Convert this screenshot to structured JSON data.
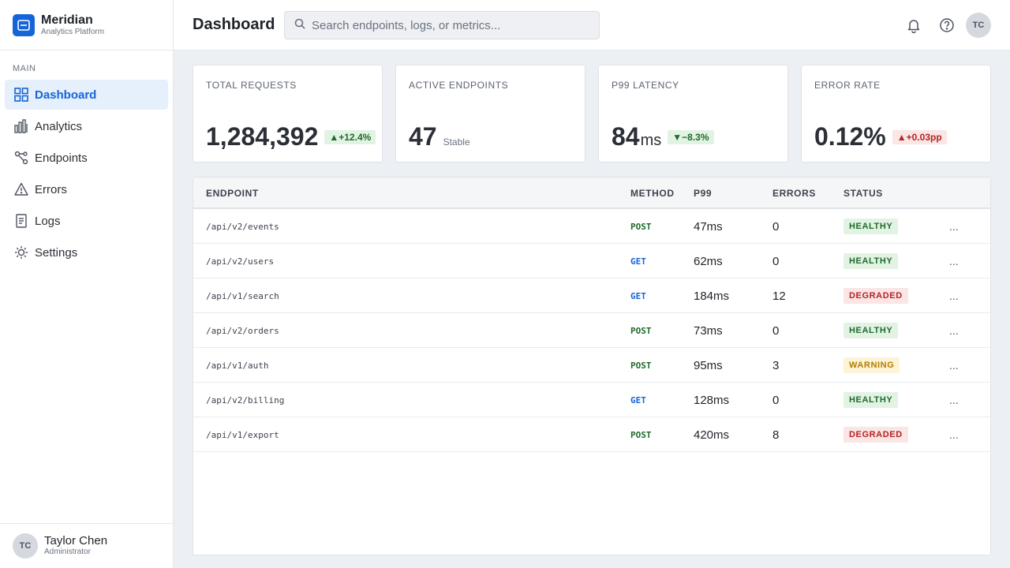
{
  "brand": {
    "name": "Meridian",
    "subtitle": "Analytics Platform"
  },
  "sidebar": {
    "section_label": "MAIN",
    "items": [
      {
        "label": "Dashboard",
        "icon": "grid-icon",
        "active": true
      },
      {
        "label": "Analytics",
        "icon": "bar-chart-icon",
        "active": false
      },
      {
        "label": "Endpoints",
        "icon": "nodes-icon",
        "active": false
      },
      {
        "label": "Errors",
        "icon": "warning-icon",
        "active": false
      },
      {
        "label": "Logs",
        "icon": "document-icon",
        "active": false
      },
      {
        "label": "Settings",
        "icon": "gear-icon",
        "active": false
      }
    ],
    "user": {
      "initials": "TC",
      "name": "Taylor Chen",
      "role": "Administrator"
    }
  },
  "header": {
    "title": "Dashboard",
    "search_placeholder": "Search endpoints, logs, or metrics...",
    "avatar_initials": "TC"
  },
  "cards": [
    {
      "label": "TOTAL REQUESTS",
      "value": "1,284,392",
      "unit": "",
      "delta": "+12.4%",
      "delta_dir": "up",
      "delta_tone": "good",
      "note": ""
    },
    {
      "label": "ACTIVE ENDPOINTS",
      "value": "47",
      "unit": "",
      "delta": "",
      "delta_dir": "",
      "delta_tone": "",
      "note": "Stable"
    },
    {
      "label": "P99 LATENCY",
      "value": "84",
      "unit": "ms",
      "delta": "−8.3%",
      "delta_dir": "down",
      "delta_tone": "good",
      "note": ""
    },
    {
      "label": "ERROR RATE",
      "value": "0.12%",
      "unit": "",
      "delta": "+0.03pp",
      "delta_dir": "up",
      "delta_tone": "bad",
      "note": ""
    }
  ],
  "table": {
    "columns": [
      "ENDPOINT",
      "METHOD",
      "P99",
      "ERRORS",
      "STATUS"
    ],
    "rows": [
      {
        "endpoint": "/api/v2/events",
        "method": "POST",
        "p99": "47ms",
        "errors": "0",
        "status": "HEALTHY"
      },
      {
        "endpoint": "/api/v2/users",
        "method": "GET",
        "p99": "62ms",
        "errors": "0",
        "status": "HEALTHY"
      },
      {
        "endpoint": "/api/v1/search",
        "method": "GET",
        "p99": "184ms",
        "errors": "12",
        "status": "DEGRADED"
      },
      {
        "endpoint": "/api/v2/orders",
        "method": "POST",
        "p99": "73ms",
        "errors": "0",
        "status": "HEALTHY"
      },
      {
        "endpoint": "/api/v1/auth",
        "method": "POST",
        "p99": "95ms",
        "errors": "3",
        "status": "WARNING"
      },
      {
        "endpoint": "/api/v2/billing",
        "method": "GET",
        "p99": "128ms",
        "errors": "0",
        "status": "HEALTHY"
      },
      {
        "endpoint": "/api/v1/export",
        "method": "POST",
        "p99": "420ms",
        "errors": "8",
        "status": "DEGRADED"
      }
    ],
    "row_action": "..."
  },
  "colors": {
    "accent": "#1565d8",
    "post": "#1e6b2b",
    "get": "#1565d8",
    "healthy_bg": "#e2f3e4",
    "healthy_fg": "#1e6b2b",
    "degraded_bg": "#fbe5e5",
    "degraded_fg": "#b42424",
    "warning_bg": "#fdf3d6",
    "warning_fg": "#b07d00"
  }
}
